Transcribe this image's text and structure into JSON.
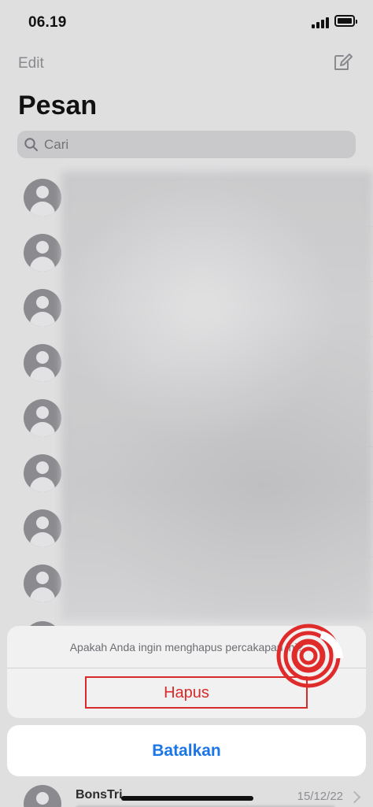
{
  "status_bar": {
    "time": "06.19",
    "signal_level": 4,
    "battery_level": 0.8
  },
  "header": {
    "edit_label": "Edit",
    "compose_icon": "compose-icon",
    "title": "Pesan"
  },
  "search": {
    "placeholder": "Cari",
    "icon": "search-icon"
  },
  "chats": {
    "blurred_count": 8,
    "bottom_item": {
      "name": "BonsTri",
      "date": "15/12/22"
    }
  },
  "action_sheet": {
    "message": "Apakah Anda ingin menghapus percakapan ini?",
    "hapus_label": "Hapus",
    "cancel_label": "Batalkan",
    "destructive_color": "#d82c2a",
    "accent_color": "#1b76e8"
  },
  "highlight": {
    "color": "#d72a2a"
  }
}
